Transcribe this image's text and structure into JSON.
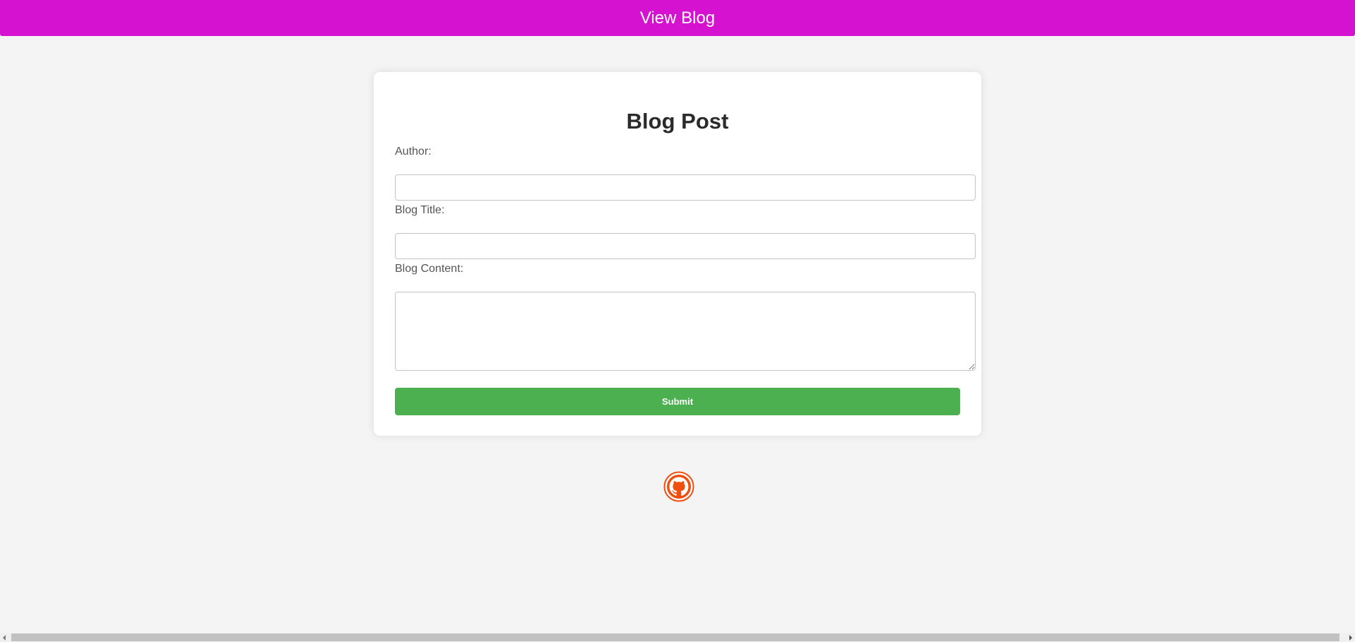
{
  "header": {
    "title": "View Blog",
    "background": "#d412d0"
  },
  "form": {
    "heading": "Blog Post",
    "author_label": "Author:",
    "author_value": "",
    "title_label": "Blog Title:",
    "title_value": "",
    "content_label": "Blog Content:",
    "content_value": "",
    "submit_label": "Submit",
    "submit_color": "#4caf50"
  },
  "footer": {
    "github_icon": "github-icon",
    "github_color": "#f04e0e"
  }
}
